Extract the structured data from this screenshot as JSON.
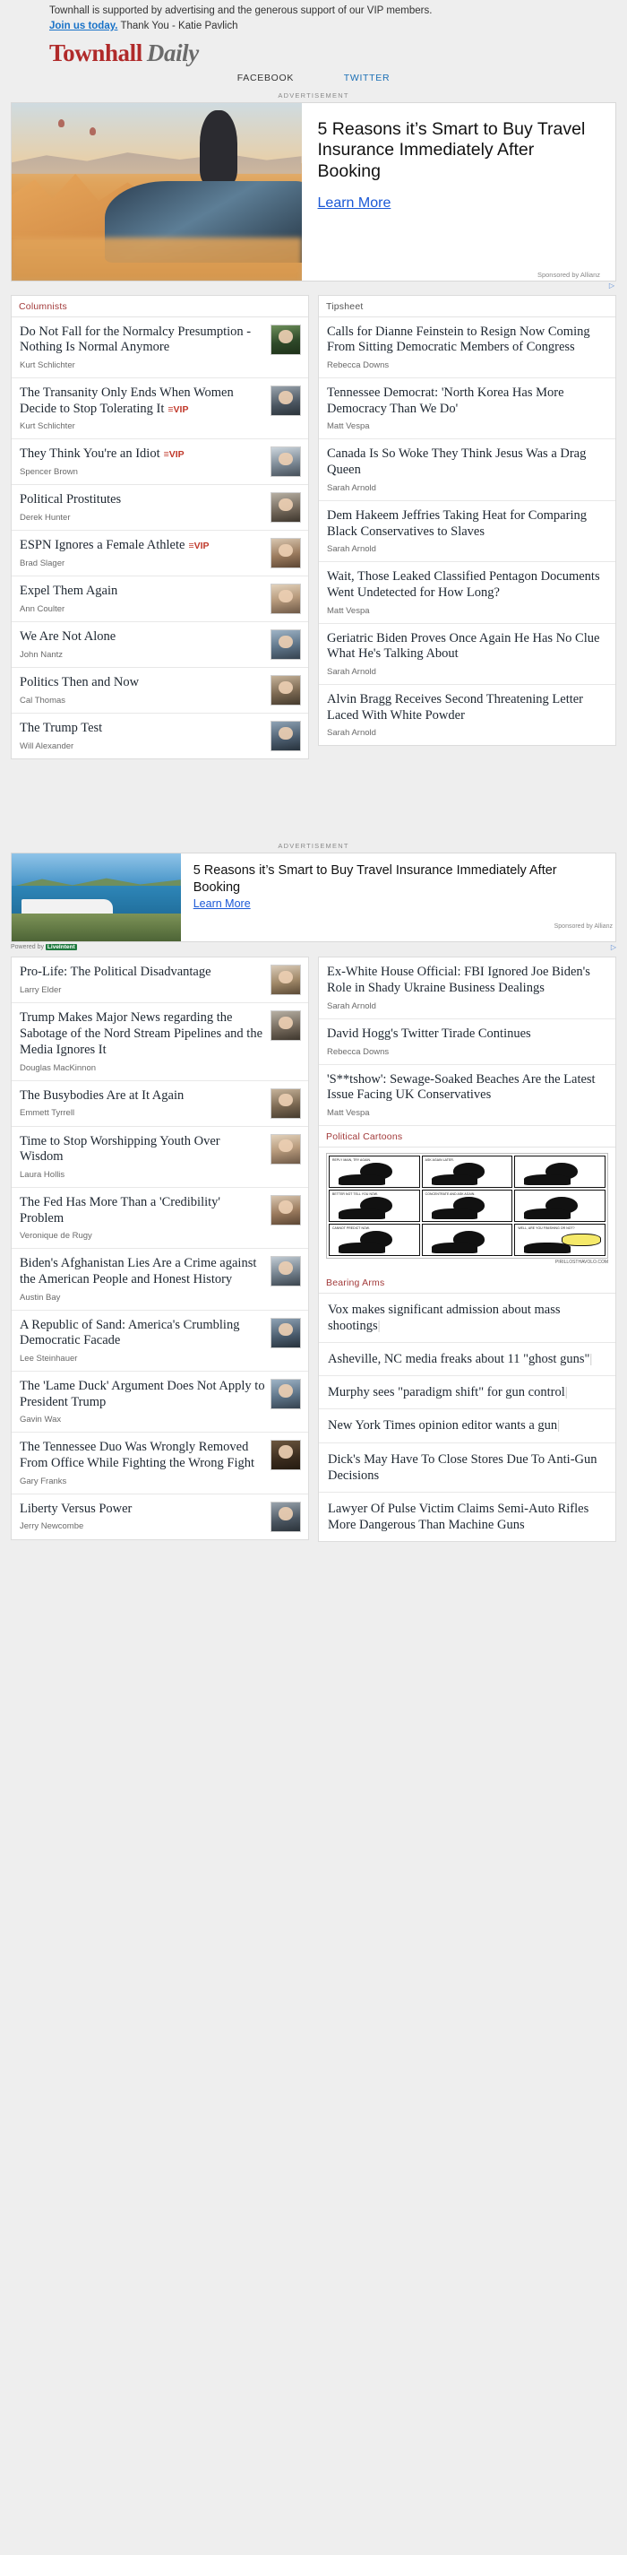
{
  "support": {
    "line1": "Townhall is supported by advertising and the generous support of our VIP members.",
    "link": "Join us today.",
    "line2": " Thank You - Katie Pavlich"
  },
  "brand": {
    "primary": "Townhall",
    "secondary": "Daily",
    "color_primary": "#b02a2a",
    "color_secondary": "#6b6b6b"
  },
  "nav": {
    "items": [
      {
        "label": "FACEBOOK"
      },
      {
        "label": "TWITTER"
      }
    ]
  },
  "ads": {
    "label": "ADVERTISEMENT",
    "top": {
      "headline": "5 Reasons it’s Smart to Buy Travel Insurance Immediately After Booking",
      "cta": "Learn More",
      "sponsor": "Sponsored by Allianz",
      "choice": "▷"
    },
    "mid": {
      "headline": "5 Reasons it’s Smart to Buy Travel Insurance Immediately After Booking",
      "cta": "Learn More",
      "sponsor": "Sponsored by Allianz",
      "powered_prefix": "Powered by",
      "powered_brand": "LiveIntent",
      "adchoices": "▷"
    }
  },
  "sections": {
    "columnists": {
      "title": "Columnists"
    },
    "tipsheet": {
      "title": "Tipsheet"
    },
    "cartoons": {
      "title": "Political Cartoons"
    },
    "bearing_arms": {
      "title": "Bearing Arms"
    }
  },
  "columnists_top": [
    {
      "title": "Do Not Fall for the Normalcy Presumption - Nothing Is Normal Anymore",
      "author": "Kurt Schlichter",
      "vip": "",
      "thumb": "p-a"
    },
    {
      "title": "The Transanity Only Ends When Women Decide to Stop Tolerating It",
      "author": "Kurt Schlichter",
      "vip": "≡VIP",
      "thumb": "p-b"
    },
    {
      "title": "They Think You're an Idiot",
      "author": "Spencer Brown",
      "vip": "≡VIP",
      "thumb": "p-c"
    },
    {
      "title": "Political Prostitutes",
      "author": "Derek Hunter",
      "vip": "",
      "thumb": "p-d"
    },
    {
      "title": "ESPN Ignores a Female Athlete",
      "author": "Brad Slager",
      "vip": "≡VIP",
      "thumb": "p-e"
    },
    {
      "title": "Expel Them Again",
      "author": "Ann Coulter",
      "vip": "",
      "thumb": "p-f"
    },
    {
      "title": "We Are Not Alone",
      "author": "John Nantz",
      "vip": "",
      "thumb": "p-g"
    },
    {
      "title": "Politics Then and Now",
      "author": "Cal Thomas",
      "vip": "",
      "thumb": "p-h"
    },
    {
      "title": "The Trump Test",
      "author": "Will Alexander",
      "vip": "",
      "thumb": "p-i"
    }
  ],
  "tipsheet": [
    {
      "title": "Calls for Dianne Feinstein to Resign Now Coming From Sitting Democratic Members of Congress",
      "author": "Rebecca Downs"
    },
    {
      "title": "Tennessee Democrat: 'North Korea Has More Democracy Than We Do'",
      "author": "Matt Vespa"
    },
    {
      "title": "Canada Is So Woke They Think Jesus Was a Drag Queen",
      "author": "Sarah Arnold"
    },
    {
      "title": "Dem Hakeem Jeffries Taking Heat for Comparing Black Conservatives to Slaves",
      "author": "Sarah Arnold"
    },
    {
      "title": "Wait, Those Leaked Classified Pentagon Documents Went Undetected for How Long?",
      "author": "Matt Vespa"
    },
    {
      "title": "Geriatric Biden Proves Once Again He Has No Clue What He's Talking About",
      "author": "Sarah Arnold"
    },
    {
      "title": "Alvin Bragg Receives Second Threatening Letter Laced With White Powder",
      "author": "Sarah Arnold"
    }
  ],
  "columnists_bottom": [
    {
      "title": "Pro-Life: The Political Disadvantage",
      "author": "Larry Elder",
      "thumb": "p-j"
    },
    {
      "title": "Trump Makes Major News regarding the Sabotage of the Nord Stream Pipelines and the Media Ignores It",
      "author": "Douglas MacKinnon",
      "thumb": "p-d"
    },
    {
      "title": "The Busybodies Are at It Again",
      "author": "Emmett Tyrrell",
      "thumb": "p-h"
    },
    {
      "title": "Time to Stop Worshipping Youth Over Wisdom",
      "author": "Laura Hollis",
      "thumb": "p-f"
    },
    {
      "title": "The Fed Has More Than a 'Credibility' Problem",
      "author": "Veronique de Rugy",
      "thumb": "p-e"
    },
    {
      "title": "Biden's Afghanistan Lies Are a Crime against the American People and Honest History",
      "author": "Austin Bay",
      "thumb": "p-l"
    },
    {
      "title": "A Republic of Sand: America's Crumbling Democratic Facade",
      "author": "Lee Steinhauer",
      "thumb": "p-i"
    },
    {
      "title": "The 'Lame Duck' Argument Does Not Apply to President Trump",
      "author": "Gavin Wax",
      "thumb": "p-g"
    },
    {
      "title": "The Tennessee Duo Was Wrongly Removed From Office While Fighting the Wrong Fight",
      "author": "Gary Franks",
      "thumb": "p-k"
    },
    {
      "title": "Liberty Versus Power",
      "author": "Jerry Newcombe",
      "thumb": "p-b"
    }
  ],
  "tipsheet_bottom": [
    {
      "title": "Ex-White House Official: FBI Ignored Joe Biden's Role in Shady Ukraine Business Dealings",
      "author": "Sarah Arnold"
    },
    {
      "title": "David Hogg's Twitter Tirade Continues",
      "author": "Rebecca Downs"
    },
    {
      "title": "'S**tshow': Sewage-Soaked Beaches Are the Latest Issue Facing UK Conservatives",
      "author": "Matt Vespa"
    }
  ],
  "cartoon": {
    "panels": [
      {
        "caption": "REPLY MAIN, TRY AGAIN."
      },
      {
        "caption": "ASK AGAIN LATER."
      },
      {
        "caption": "BETTER NOT TELL YOU NOW."
      },
      {
        "caption": "CONCENTRATE AND ASK AGAIN."
      },
      {
        "caption": "CANNOT PREDICT NOW."
      },
      {
        "caption": "WELL, ARE YOU FINISHING OR NOT?"
      }
    ],
    "credit": "PIRILLOSTHAVOLO.COM"
  },
  "bearing_arms": [
    {
      "title": "Vox makes significant admission about mass shootings"
    },
    {
      "title": "Asheville, NC media freaks about 11 \"ghost guns\""
    },
    {
      "title": "Murphy sees \"paradigm shift\" for gun control"
    },
    {
      "title": "New York Times opinion editor wants a gun"
    },
    {
      "title": "Dick's May Have To Close Stores Due To Anti-Gun Decisions"
    },
    {
      "title": "Lawyer Of Pulse Victim Claims Semi-Auto Rifles More Dangerous Than Machine Guns"
    }
  ]
}
